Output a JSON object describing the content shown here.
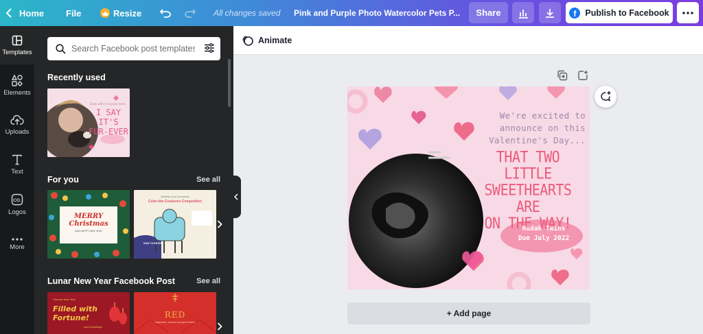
{
  "topbar": {
    "home_label": "Home",
    "file_label": "File",
    "resize_label": "Resize",
    "save_status": "All changes saved",
    "document_title": "Pink and Purple Photo Watercolor Pets P...",
    "share_label": "Share",
    "publish_label": "Publish to Facebook",
    "colors": {
      "gradient_start": "#2bb6c9",
      "gradient_end": "#7b3de0"
    }
  },
  "rail": {
    "items": [
      {
        "label": "Templates",
        "icon": "templates-icon"
      },
      {
        "label": "Elements",
        "icon": "elements-icon"
      },
      {
        "label": "Uploads",
        "icon": "uploads-icon"
      },
      {
        "label": "Text",
        "icon": "text-icon"
      },
      {
        "label": "Logos",
        "icon": "logos-icon"
      },
      {
        "label": "More",
        "icon": "more-icon"
      }
    ]
  },
  "panel": {
    "search_placeholder": "Search Facebook post templates",
    "recently_used": {
      "title": "Recently used",
      "thumb": {
        "line1": "Snow with it anyway here...",
        "headline": "I SAY IT'S\nFUR-EVER"
      }
    },
    "for_you": {
      "title": "For you",
      "see_all": "See all",
      "thumbs": [
        {
          "headline": "MERRY\nChristmas",
          "sub": "AND HAPPY NEW YEAR"
        },
        {
          "line1": "Newville Local Documents",
          "headline": "Color-the-Creatures-Competition",
          "footer": "HOW TO ENTER"
        }
      ]
    },
    "lunar": {
      "title": "Lunar New Year Facebook Post",
      "see_all": "See all",
      "thumbs": [
        {
          "line1": "Chinese New Year",
          "headline": "Filled with\nFortune!",
          "footer": "...and dumplings."
        },
        {
          "headline": "RED",
          "sub": "Happiness, success and good fortune"
        }
      ]
    }
  },
  "canvas": {
    "animate_label": "Animate",
    "add_page_label": "+ Add page",
    "design": {
      "intro": "We're excited to\nannounce on this\nValentine's Day...",
      "headline": "THAT TWO LITTLE\nSWEETHEARTS ARE\nON THE WAY!",
      "names": "Hudak Twins\nDue July 2022",
      "colors": {
        "background": "#f8d9e6",
        "headline": "#ec5a7a",
        "intro": "#9d8aa8"
      }
    }
  }
}
